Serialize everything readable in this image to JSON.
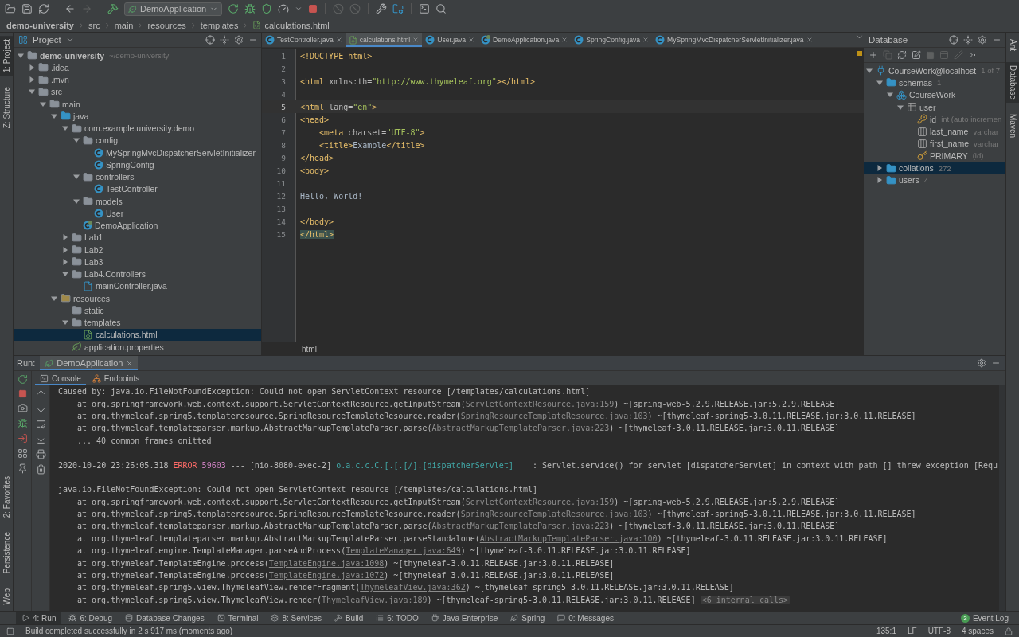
{
  "toolbar": {
    "run_config": "DemoApplication"
  },
  "breadcrumbs": [
    "demo-university",
    "src",
    "main",
    "resources",
    "templates",
    "calculations.html"
  ],
  "left_stripe": {
    "top": [
      {
        "label": "1: Project",
        "selected": true
      },
      {
        "label": "Z: Structure",
        "selected": false
      }
    ],
    "bottom": [
      {
        "label": "2: Favorites",
        "selected": false
      },
      {
        "label": "Persistence",
        "selected": false
      },
      {
        "label": "Web",
        "selected": false
      }
    ]
  },
  "project": {
    "title": "Project",
    "tree": [
      {
        "label": "demo-university",
        "hint": "~/demo-university",
        "kind": "module",
        "expanded": true,
        "selected": false,
        "children": [
          {
            "label": ".idea",
            "kind": "folder",
            "expanded": false,
            "selected": false
          },
          {
            "label": ".mvn",
            "kind": "folder",
            "expanded": false,
            "selected": false
          },
          {
            "label": "src",
            "kind": "folder",
            "expanded": true,
            "selected": false,
            "children": [
              {
                "label": "main",
                "kind": "folder",
                "expanded": true,
                "selected": false,
                "children": [
                  {
                    "label": "java",
                    "kind": "source-folder",
                    "expanded": true,
                    "selected": false,
                    "children": [
                      {
                        "label": "com.example.university.demo",
                        "kind": "package",
                        "expanded": true,
                        "selected": false,
                        "children": [
                          {
                            "label": "config",
                            "kind": "package",
                            "expanded": true,
                            "selected": false,
                            "children": [
                              {
                                "label": "MySpringMvcDispatcherServletInitializer",
                                "kind": "class",
                                "selected": false
                              },
                              {
                                "label": "SpringConfig",
                                "kind": "class",
                                "selected": false
                              }
                            ]
                          },
                          {
                            "label": "controllers",
                            "kind": "package",
                            "expanded": true,
                            "selected": false,
                            "children": [
                              {
                                "label": "TestController",
                                "kind": "class",
                                "selected": false
                              }
                            ]
                          },
                          {
                            "label": "models",
                            "kind": "package",
                            "expanded": true,
                            "selected": false,
                            "children": [
                              {
                                "label": "User",
                                "kind": "class",
                                "selected": false
                              }
                            ]
                          },
                          {
                            "label": "DemoApplication",
                            "kind": "spring-class",
                            "selected": false
                          }
                        ]
                      },
                      {
                        "label": "Lab1",
                        "kind": "package",
                        "expanded": false,
                        "selected": false
                      },
                      {
                        "label": "Lab2",
                        "kind": "package",
                        "expanded": false,
                        "selected": false
                      },
                      {
                        "label": "Lab3",
                        "kind": "package",
                        "expanded": false,
                        "selected": false
                      },
                      {
                        "label": "Lab4.Controllers",
                        "kind": "package",
                        "expanded": true,
                        "selected": false,
                        "children": [
                          {
                            "label": "mainController.java",
                            "kind": "java-file",
                            "selected": false
                          }
                        ]
                      }
                    ]
                  },
                  {
                    "label": "resources",
                    "kind": "resources-folder",
                    "expanded": true,
                    "selected": false,
                    "children": [
                      {
                        "label": "static",
                        "kind": "folder",
                        "selected": false
                      },
                      {
                        "label": "templates",
                        "kind": "folder",
                        "expanded": true,
                        "selected": false,
                        "children": [
                          {
                            "label": "calculations.html",
                            "kind": "html",
                            "selected": true
                          }
                        ]
                      },
                      {
                        "label": "application.properties",
                        "kind": "properties",
                        "selected": false
                      }
                    ]
                  }
                ]
              }
            ]
          }
        ]
      }
    ]
  },
  "editor": {
    "tabs": [
      {
        "label": "TestController.java",
        "kind": "java",
        "selected": false
      },
      {
        "label": "calculations.html",
        "kind": "html",
        "selected": true
      },
      {
        "label": "User.java",
        "kind": "java",
        "selected": false
      },
      {
        "label": "DemoApplication.java",
        "kind": "spring",
        "selected": false
      },
      {
        "label": "SpringConfig.java",
        "kind": "java",
        "selected": false
      },
      {
        "label": "MySpringMvcDispatcherServletInitializer.java",
        "kind": "java",
        "selected": false
      }
    ],
    "lines": [
      {
        "number": "1",
        "current": false,
        "segments": [
          {
            "text": "<!DOCTYPE html>",
            "kind": "tag"
          }
        ]
      },
      {
        "number": "2",
        "current": false
      },
      {
        "number": "3",
        "current": false,
        "segments": [
          {
            "text": "<html",
            "kind": "tag"
          },
          {
            "text": " xmlns:th=",
            "kind": "attr"
          },
          {
            "text": "\"http://www.thymeleaf.org\"",
            "kind": "value"
          },
          {
            "text": "></html>",
            "kind": "tag"
          }
        ]
      },
      {
        "number": "4",
        "current": false
      },
      {
        "number": "5",
        "current": true,
        "segments": [
          {
            "text": "<html",
            "kind": "tag"
          },
          {
            "text": " lang=",
            "kind": "attr"
          },
          {
            "text": "\"en\"",
            "kind": "value"
          },
          {
            "text": ">",
            "kind": "tag"
          }
        ]
      },
      {
        "number": "6",
        "current": false,
        "segments": [
          {
            "text": "<head>",
            "kind": "tag"
          }
        ]
      },
      {
        "number": "7",
        "current": false,
        "segments": [
          {
            "text": "    <meta",
            "kind": "tag"
          },
          {
            "text": " charset=",
            "kind": "attr"
          },
          {
            "text": "\"UTF-8\"",
            "kind": "value"
          },
          {
            "text": ">",
            "kind": "tag"
          }
        ]
      },
      {
        "number": "8",
        "current": false,
        "segments": [
          {
            "text": "    <title>",
            "kind": "tag"
          },
          {
            "text": "Example",
            "kind": "text"
          },
          {
            "text": "</title>",
            "kind": "tag"
          }
        ]
      },
      {
        "number": "9",
        "current": false,
        "segments": [
          {
            "text": "</head>",
            "kind": "tag"
          }
        ]
      },
      {
        "number": "10",
        "current": false,
        "segments": [
          {
            "text": "<body>",
            "kind": "tag"
          }
        ]
      },
      {
        "number": "11",
        "current": false
      },
      {
        "number": "12",
        "current": false,
        "segments": [
          {
            "text": "Hello, World!",
            "kind": "text"
          }
        ]
      },
      {
        "number": "13",
        "current": false
      },
      {
        "number": "14",
        "current": false,
        "segments": [
          {
            "text": "</body>",
            "kind": "tag"
          }
        ]
      },
      {
        "number": "15",
        "current": false,
        "segments": [
          {
            "text": "</html>",
            "kind": "matched-tag"
          }
        ]
      }
    ],
    "breadcrumb": "html"
  },
  "database": {
    "title": "Database",
    "tree": [
      {
        "label": "CourseWork@localhost",
        "hint": "1 of 7",
        "kind": "datasource",
        "expanded": true,
        "selected": false,
        "children": [
          {
            "label": "schemas",
            "hint": "1",
            "kind": "folder",
            "expanded": true,
            "selected": false,
            "children": [
              {
                "label": "CourseWork",
                "kind": "schema",
                "expanded": true,
                "selected": false,
                "children": [
                  {
                    "label": "user",
                    "kind": "table",
                    "expanded": true,
                    "selected": false,
                    "children": [
                      {
                        "label": "id",
                        "hint": "int (auto incremen",
                        "kind": "key-column",
                        "selected": false
                      },
                      {
                        "label": "last_name",
                        "hint": "varchar",
                        "kind": "column",
                        "selected": false
                      },
                      {
                        "label": "first_name",
                        "hint": "varchar",
                        "kind": "column",
                        "selected": false
                      },
                      {
                        "label": "PRIMARY",
                        "hint": "(id)",
                        "kind": "index",
                        "selected": false
                      }
                    ]
                  }
                ]
              }
            ]
          },
          {
            "label": "collations",
            "hint": "272",
            "kind": "folder",
            "expanded": false,
            "selected": true
          },
          {
            "label": "users",
            "hint": "4",
            "kind": "folder",
            "expanded": false,
            "selected": false
          }
        ]
      }
    ]
  },
  "right_stripe": [
    {
      "label": "Ant",
      "selected": false
    },
    {
      "label": "Database",
      "selected": true
    },
    {
      "label": "Maven",
      "selected": false
    }
  ],
  "run": {
    "label": "Run:",
    "tabs": [
      {
        "label": "DemoApplication",
        "selected": true
      }
    ],
    "subtabs": [
      {
        "label": "Console",
        "kind": "console",
        "selected": true
      },
      {
        "label": "Endpoints",
        "kind": "endpoints",
        "selected": false
      }
    ],
    "console": [
      {
        "kind": "message",
        "segments": [
          {
            "text": "Caused by: java.io.FileNotFoundException: Could not open ServletContext resource [/templates/calculations.html]",
            "kind": "plain"
          }
        ]
      },
      {
        "kind": "trace",
        "segments": [
          {
            "text": "at org.springframework.web.context.support.ServletContextResource.getInputStream(",
            "kind": "plain"
          },
          {
            "text": "ServletContextResource.java:159",
            "kind": "link"
          },
          {
            "text": ") ~[spring-web-5.2.9.RELEASE.jar:5.2.9.RELEASE]",
            "kind": "plain"
          }
        ]
      },
      {
        "kind": "trace",
        "segments": [
          {
            "text": "at org.thymeleaf.spring5.templateresource.SpringResourceTemplateResource.reader(",
            "kind": "plain"
          },
          {
            "text": "SpringResourceTemplateResource.java:103",
            "kind": "link"
          },
          {
            "text": ") ~[thymeleaf-spring5-3.0.11.RELEASE.jar:3.0.11.RELEASE]",
            "kind": "plain"
          }
        ]
      },
      {
        "kind": "trace",
        "segments": [
          {
            "text": "at org.thymeleaf.templateparser.markup.AbstractMarkupTemplateParser.parse(",
            "kind": "plain"
          },
          {
            "text": "AbstractMarkupTemplateParser.java:223",
            "kind": "link"
          },
          {
            "text": ") ~[thymeleaf-3.0.11.RELEASE.jar:3.0.11.RELEASE]",
            "kind": "plain"
          }
        ]
      },
      {
        "kind": "trace",
        "segments": [
          {
            "text": "... 40 common frames omitted",
            "kind": "plain"
          }
        ]
      },
      {
        "kind": "blank"
      },
      {
        "kind": "message",
        "segments": [
          {
            "text": "2020-10-20 23:26:05.318 ",
            "kind": "plain"
          },
          {
            "text": "ERROR",
            "kind": "error"
          },
          {
            "text": "59603",
            "kind": "pid"
          },
          {
            "text": "--- [nio-8080-exec-2] ",
            "kind": "plain"
          },
          {
            "text": "o.a.c.c.C.[.[.[/].[dispatcherServlet]",
            "kind": "logger"
          },
          {
            "text": "    : Servlet.service() for servlet [dispatcherServlet] in context with path [] threw exception [Requ",
            "kind": "plain"
          }
        ]
      },
      {
        "kind": "blank"
      },
      {
        "kind": "message",
        "segments": [
          {
            "text": "java.io.FileNotFoundException: Could not open ServletContext resource [/templates/calculations.html]",
            "kind": "plain"
          }
        ]
      },
      {
        "kind": "trace",
        "segments": [
          {
            "text": "at org.springframework.web.context.support.ServletContextResource.getInputStream(",
            "kind": "plain"
          },
          {
            "text": "ServletContextResource.java:159",
            "kind": "link"
          },
          {
            "text": ") ~[spring-web-5.2.9.RELEASE.jar:5.2.9.RELEASE]",
            "kind": "plain"
          }
        ]
      },
      {
        "kind": "trace",
        "segments": [
          {
            "text": "at org.thymeleaf.spring5.templateresource.SpringResourceTemplateResource.reader(",
            "kind": "plain"
          },
          {
            "text": "SpringResourceTemplateResource.java:103",
            "kind": "link"
          },
          {
            "text": ") ~[thymeleaf-spring5-3.0.11.RELEASE.jar:3.0.11.RELEASE]",
            "kind": "plain"
          }
        ]
      },
      {
        "kind": "trace",
        "segments": [
          {
            "text": "at org.thymeleaf.templateparser.markup.AbstractMarkupTemplateParser.parse(",
            "kind": "plain"
          },
          {
            "text": "AbstractMarkupTemplateParser.java:223",
            "kind": "link"
          },
          {
            "text": ") ~[thymeleaf-3.0.11.RELEASE.jar:3.0.11.RELEASE]",
            "kind": "plain"
          }
        ]
      },
      {
        "kind": "trace",
        "segments": [
          {
            "text": "at org.thymeleaf.templateparser.markup.AbstractMarkupTemplateParser.parseStandalone(",
            "kind": "plain"
          },
          {
            "text": "AbstractMarkupTemplateParser.java:100",
            "kind": "link"
          },
          {
            "text": ") ~[thymeleaf-3.0.11.RELEASE.jar:3.0.11.RELEASE]",
            "kind": "plain"
          }
        ]
      },
      {
        "kind": "trace",
        "segments": [
          {
            "text": "at org.thymeleaf.engine.TemplateManager.parseAndProcess(",
            "kind": "plain"
          },
          {
            "text": "TemplateManager.java:649",
            "kind": "link"
          },
          {
            "text": ") ~[thymeleaf-3.0.11.RELEASE.jar:3.0.11.RELEASE]",
            "kind": "plain"
          }
        ]
      },
      {
        "kind": "trace",
        "segments": [
          {
            "text": "at org.thymeleaf.TemplateEngine.process(",
            "kind": "plain"
          },
          {
            "text": "TemplateEngine.java:1098",
            "kind": "link"
          },
          {
            "text": ") ~[thymeleaf-3.0.11.RELEASE.jar:3.0.11.RELEASE]",
            "kind": "plain"
          }
        ]
      },
      {
        "kind": "trace",
        "segments": [
          {
            "text": "at org.thymeleaf.TemplateEngine.process(",
            "kind": "plain"
          },
          {
            "text": "TemplateEngine.java:1072",
            "kind": "link"
          },
          {
            "text": ") ~[thymeleaf-3.0.11.RELEASE.jar:3.0.11.RELEASE]",
            "kind": "plain"
          }
        ]
      },
      {
        "kind": "trace",
        "segments": [
          {
            "text": "at org.thymeleaf.spring5.view.ThymeleafView.renderFragment(",
            "kind": "plain"
          },
          {
            "text": "ThymeleafView.java:362",
            "kind": "link"
          },
          {
            "text": ") ~[thymeleaf-spring5-3.0.11.RELEASE.jar:3.0.11.RELEASE]",
            "kind": "plain"
          }
        ]
      },
      {
        "kind": "trace",
        "segments": [
          {
            "text": "at org.thymeleaf.spring5.view.ThymeleafView.render(",
            "kind": "plain"
          },
          {
            "text": "ThymeleafView.java:189",
            "kind": "link"
          },
          {
            "text": ") ~[thymeleaf-spring5-3.0.11.RELEASE.jar:3.0.11.RELEASE]",
            "kind": "plain"
          },
          {
            "text": "<6 internal calls>",
            "kind": "fold"
          }
        ]
      }
    ]
  },
  "tool_windows": [
    {
      "label": "4: Run",
      "kind": "run",
      "selected": true
    },
    {
      "label": "6: Debug",
      "kind": "debug",
      "selected": false
    },
    {
      "label": "Database Changes",
      "kind": "database",
      "selected": false
    },
    {
      "label": "Terminal",
      "kind": "terminal",
      "selected": false
    },
    {
      "label": "8: Services",
      "kind": "services",
      "selected": false
    },
    {
      "label": "Build",
      "kind": "build",
      "selected": false
    },
    {
      "label": "6: TODO",
      "kind": "todo",
      "selected": false
    },
    {
      "label": "Java Enterprise",
      "kind": "enterprise",
      "selected": false
    },
    {
      "label": "Spring",
      "kind": "spring",
      "selected": false
    },
    {
      "label": "0: Messages",
      "kind": "messages",
      "selected": false
    }
  ],
  "event_log": {
    "label": "Event Log",
    "count": "3"
  },
  "status_bar": {
    "message": "Build completed successfully in 2 s 917 ms (moments ago)",
    "position": "135:1",
    "line_ending": "LF",
    "encoding": "UTF-8",
    "indent": "4 spaces"
  }
}
